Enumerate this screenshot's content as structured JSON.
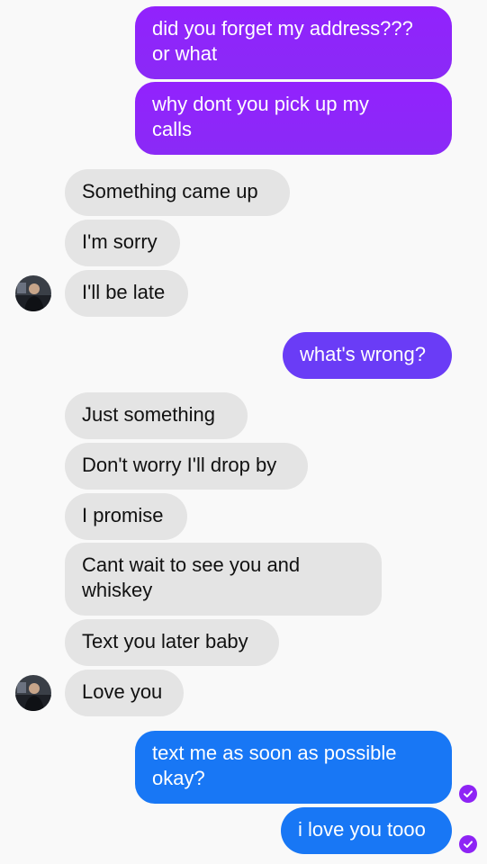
{
  "messages": [
    {
      "text": "did you forget my address???\nor what"
    },
    {
      "text": "why dont you pick up my\ncalls"
    },
    {
      "text": "Something came up"
    },
    {
      "text": "I'm sorry"
    },
    {
      "text": "I'll be late"
    },
    {
      "text": "what's wrong?"
    },
    {
      "text": "Just something"
    },
    {
      "text": "Don't worry I'll drop by"
    },
    {
      "text": "I promise"
    },
    {
      "text": "Cant wait to see you and\nwhiskey"
    },
    {
      "text": "Text you later baby"
    },
    {
      "text": "Love you"
    },
    {
      "text": "text me as soon as possible\nokay?"
    },
    {
      "text": "i love you tooo"
    }
  ],
  "colors": {
    "outgoing_purple": "#9222fd",
    "outgoing_violet": "#6a3cf6",
    "outgoing_blue": "#1877f5",
    "incoming": "#e4e4e4",
    "read_receipt": "#8e24f5"
  },
  "icons": {
    "avatar": "contact-avatar",
    "read_receipt": "check-circle-icon"
  }
}
